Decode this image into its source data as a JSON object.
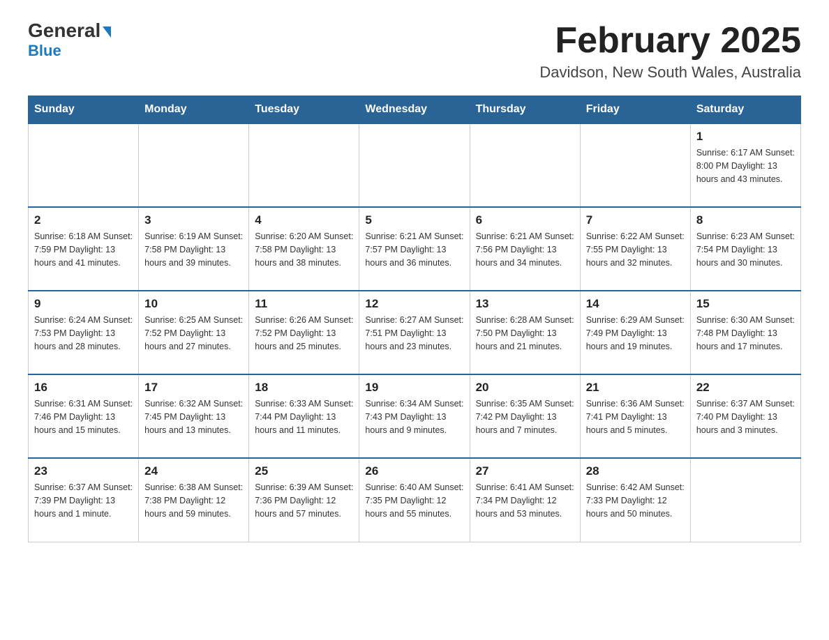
{
  "logo": {
    "general": "General",
    "blue": "Blue"
  },
  "header": {
    "month_year": "February 2025",
    "location": "Davidson, New South Wales, Australia"
  },
  "weekdays": [
    "Sunday",
    "Monday",
    "Tuesday",
    "Wednesday",
    "Thursday",
    "Friday",
    "Saturday"
  ],
  "weeks": [
    [
      {
        "day": "",
        "info": ""
      },
      {
        "day": "",
        "info": ""
      },
      {
        "day": "",
        "info": ""
      },
      {
        "day": "",
        "info": ""
      },
      {
        "day": "",
        "info": ""
      },
      {
        "day": "",
        "info": ""
      },
      {
        "day": "1",
        "info": "Sunrise: 6:17 AM\nSunset: 8:00 PM\nDaylight: 13 hours and 43 minutes."
      }
    ],
    [
      {
        "day": "2",
        "info": "Sunrise: 6:18 AM\nSunset: 7:59 PM\nDaylight: 13 hours and 41 minutes."
      },
      {
        "day": "3",
        "info": "Sunrise: 6:19 AM\nSunset: 7:58 PM\nDaylight: 13 hours and 39 minutes."
      },
      {
        "day": "4",
        "info": "Sunrise: 6:20 AM\nSunset: 7:58 PM\nDaylight: 13 hours and 38 minutes."
      },
      {
        "day": "5",
        "info": "Sunrise: 6:21 AM\nSunset: 7:57 PM\nDaylight: 13 hours and 36 minutes."
      },
      {
        "day": "6",
        "info": "Sunrise: 6:21 AM\nSunset: 7:56 PM\nDaylight: 13 hours and 34 minutes."
      },
      {
        "day": "7",
        "info": "Sunrise: 6:22 AM\nSunset: 7:55 PM\nDaylight: 13 hours and 32 minutes."
      },
      {
        "day": "8",
        "info": "Sunrise: 6:23 AM\nSunset: 7:54 PM\nDaylight: 13 hours and 30 minutes."
      }
    ],
    [
      {
        "day": "9",
        "info": "Sunrise: 6:24 AM\nSunset: 7:53 PM\nDaylight: 13 hours and 28 minutes."
      },
      {
        "day": "10",
        "info": "Sunrise: 6:25 AM\nSunset: 7:52 PM\nDaylight: 13 hours and 27 minutes."
      },
      {
        "day": "11",
        "info": "Sunrise: 6:26 AM\nSunset: 7:52 PM\nDaylight: 13 hours and 25 minutes."
      },
      {
        "day": "12",
        "info": "Sunrise: 6:27 AM\nSunset: 7:51 PM\nDaylight: 13 hours and 23 minutes."
      },
      {
        "day": "13",
        "info": "Sunrise: 6:28 AM\nSunset: 7:50 PM\nDaylight: 13 hours and 21 minutes."
      },
      {
        "day": "14",
        "info": "Sunrise: 6:29 AM\nSunset: 7:49 PM\nDaylight: 13 hours and 19 minutes."
      },
      {
        "day": "15",
        "info": "Sunrise: 6:30 AM\nSunset: 7:48 PM\nDaylight: 13 hours and 17 minutes."
      }
    ],
    [
      {
        "day": "16",
        "info": "Sunrise: 6:31 AM\nSunset: 7:46 PM\nDaylight: 13 hours and 15 minutes."
      },
      {
        "day": "17",
        "info": "Sunrise: 6:32 AM\nSunset: 7:45 PM\nDaylight: 13 hours and 13 minutes."
      },
      {
        "day": "18",
        "info": "Sunrise: 6:33 AM\nSunset: 7:44 PM\nDaylight: 13 hours and 11 minutes."
      },
      {
        "day": "19",
        "info": "Sunrise: 6:34 AM\nSunset: 7:43 PM\nDaylight: 13 hours and 9 minutes."
      },
      {
        "day": "20",
        "info": "Sunrise: 6:35 AM\nSunset: 7:42 PM\nDaylight: 13 hours and 7 minutes."
      },
      {
        "day": "21",
        "info": "Sunrise: 6:36 AM\nSunset: 7:41 PM\nDaylight: 13 hours and 5 minutes."
      },
      {
        "day": "22",
        "info": "Sunrise: 6:37 AM\nSunset: 7:40 PM\nDaylight: 13 hours and 3 minutes."
      }
    ],
    [
      {
        "day": "23",
        "info": "Sunrise: 6:37 AM\nSunset: 7:39 PM\nDaylight: 13 hours and 1 minute."
      },
      {
        "day": "24",
        "info": "Sunrise: 6:38 AM\nSunset: 7:38 PM\nDaylight: 12 hours and 59 minutes."
      },
      {
        "day": "25",
        "info": "Sunrise: 6:39 AM\nSunset: 7:36 PM\nDaylight: 12 hours and 57 minutes."
      },
      {
        "day": "26",
        "info": "Sunrise: 6:40 AM\nSunset: 7:35 PM\nDaylight: 12 hours and 55 minutes."
      },
      {
        "day": "27",
        "info": "Sunrise: 6:41 AM\nSunset: 7:34 PM\nDaylight: 12 hours and 53 minutes."
      },
      {
        "day": "28",
        "info": "Sunrise: 6:42 AM\nSunset: 7:33 PM\nDaylight: 12 hours and 50 minutes."
      },
      {
        "day": "",
        "info": ""
      }
    ]
  ]
}
